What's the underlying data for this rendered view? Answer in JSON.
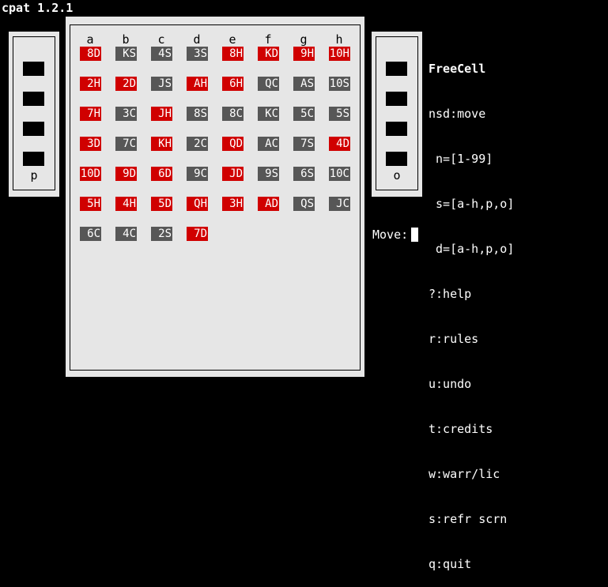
{
  "app_title": "cpat 1.2.1",
  "left_cell": {
    "label": "p"
  },
  "right_cell": {
    "label": "o"
  },
  "columns": [
    {
      "label": "a",
      "cards": [
        {
          "text": "8D",
          "color": "red"
        },
        {
          "text": "2H",
          "color": "red"
        },
        {
          "text": "7H",
          "color": "red"
        },
        {
          "text": "3D",
          "color": "red"
        },
        {
          "text": "10D",
          "color": "red"
        },
        {
          "text": "5H",
          "color": "red"
        },
        {
          "text": "6C",
          "color": "black"
        }
      ]
    },
    {
      "label": "b",
      "cards": [
        {
          "text": "KS",
          "color": "black"
        },
        {
          "text": "2D",
          "color": "red"
        },
        {
          "text": "3C",
          "color": "black"
        },
        {
          "text": "7C",
          "color": "black"
        },
        {
          "text": "9D",
          "color": "red"
        },
        {
          "text": "4H",
          "color": "red"
        },
        {
          "text": "4C",
          "color": "black"
        }
      ]
    },
    {
      "label": "c",
      "cards": [
        {
          "text": "4S",
          "color": "black"
        },
        {
          "text": "JS",
          "color": "black"
        },
        {
          "text": "JH",
          "color": "red"
        },
        {
          "text": "KH",
          "color": "red"
        },
        {
          "text": "6D",
          "color": "red"
        },
        {
          "text": "5D",
          "color": "red"
        },
        {
          "text": "2S",
          "color": "black"
        }
      ]
    },
    {
      "label": "d",
      "cards": [
        {
          "text": "3S",
          "color": "black"
        },
        {
          "text": "AH",
          "color": "red"
        },
        {
          "text": "8S",
          "color": "black"
        },
        {
          "text": "2C",
          "color": "black"
        },
        {
          "text": "9C",
          "color": "black"
        },
        {
          "text": "QH",
          "color": "red"
        },
        {
          "text": "7D",
          "color": "red"
        }
      ]
    },
    {
      "label": "e",
      "cards": [
        {
          "text": "8H",
          "color": "red"
        },
        {
          "text": "6H",
          "color": "red"
        },
        {
          "text": "8C",
          "color": "black"
        },
        {
          "text": "QD",
          "color": "red"
        },
        {
          "text": "JD",
          "color": "red"
        },
        {
          "text": "3H",
          "color": "red"
        }
      ]
    },
    {
      "label": "f",
      "cards": [
        {
          "text": "KD",
          "color": "red"
        },
        {
          "text": "QC",
          "color": "black"
        },
        {
          "text": "KC",
          "color": "black"
        },
        {
          "text": "AC",
          "color": "black"
        },
        {
          "text": "9S",
          "color": "black"
        },
        {
          "text": "AD",
          "color": "red"
        }
      ]
    },
    {
      "label": "g",
      "cards": [
        {
          "text": "9H",
          "color": "red"
        },
        {
          "text": "AS",
          "color": "black"
        },
        {
          "text": "5C",
          "color": "black"
        },
        {
          "text": "7S",
          "color": "black"
        },
        {
          "text": "6S",
          "color": "black"
        },
        {
          "text": "QS",
          "color": "black"
        }
      ]
    },
    {
      "label": "h",
      "cards": [
        {
          "text": "10H",
          "color": "red"
        },
        {
          "text": "10S",
          "color": "black"
        },
        {
          "text": "5S",
          "color": "black"
        },
        {
          "text": "4D",
          "color": "red"
        },
        {
          "text": "10C",
          "color": "black"
        },
        {
          "text": "JC",
          "color": "black"
        }
      ]
    }
  ],
  "help": {
    "game_name": "FreeCell",
    "lines": [
      "nsd:move",
      " n=[1-99]",
      " s=[a-h,p,o]",
      " d=[a-h,p,o]",
      "?:help",
      "r:rules",
      "u:undo",
      "t:credits",
      "w:warr/lic",
      "s:refr scrn",
      "q:quit"
    ]
  },
  "prompt": {
    "label": "Move:",
    "value": ""
  },
  "colors": {
    "red_card": "#d00000",
    "black_card": "#575757",
    "panel": "#e6e6e6"
  }
}
